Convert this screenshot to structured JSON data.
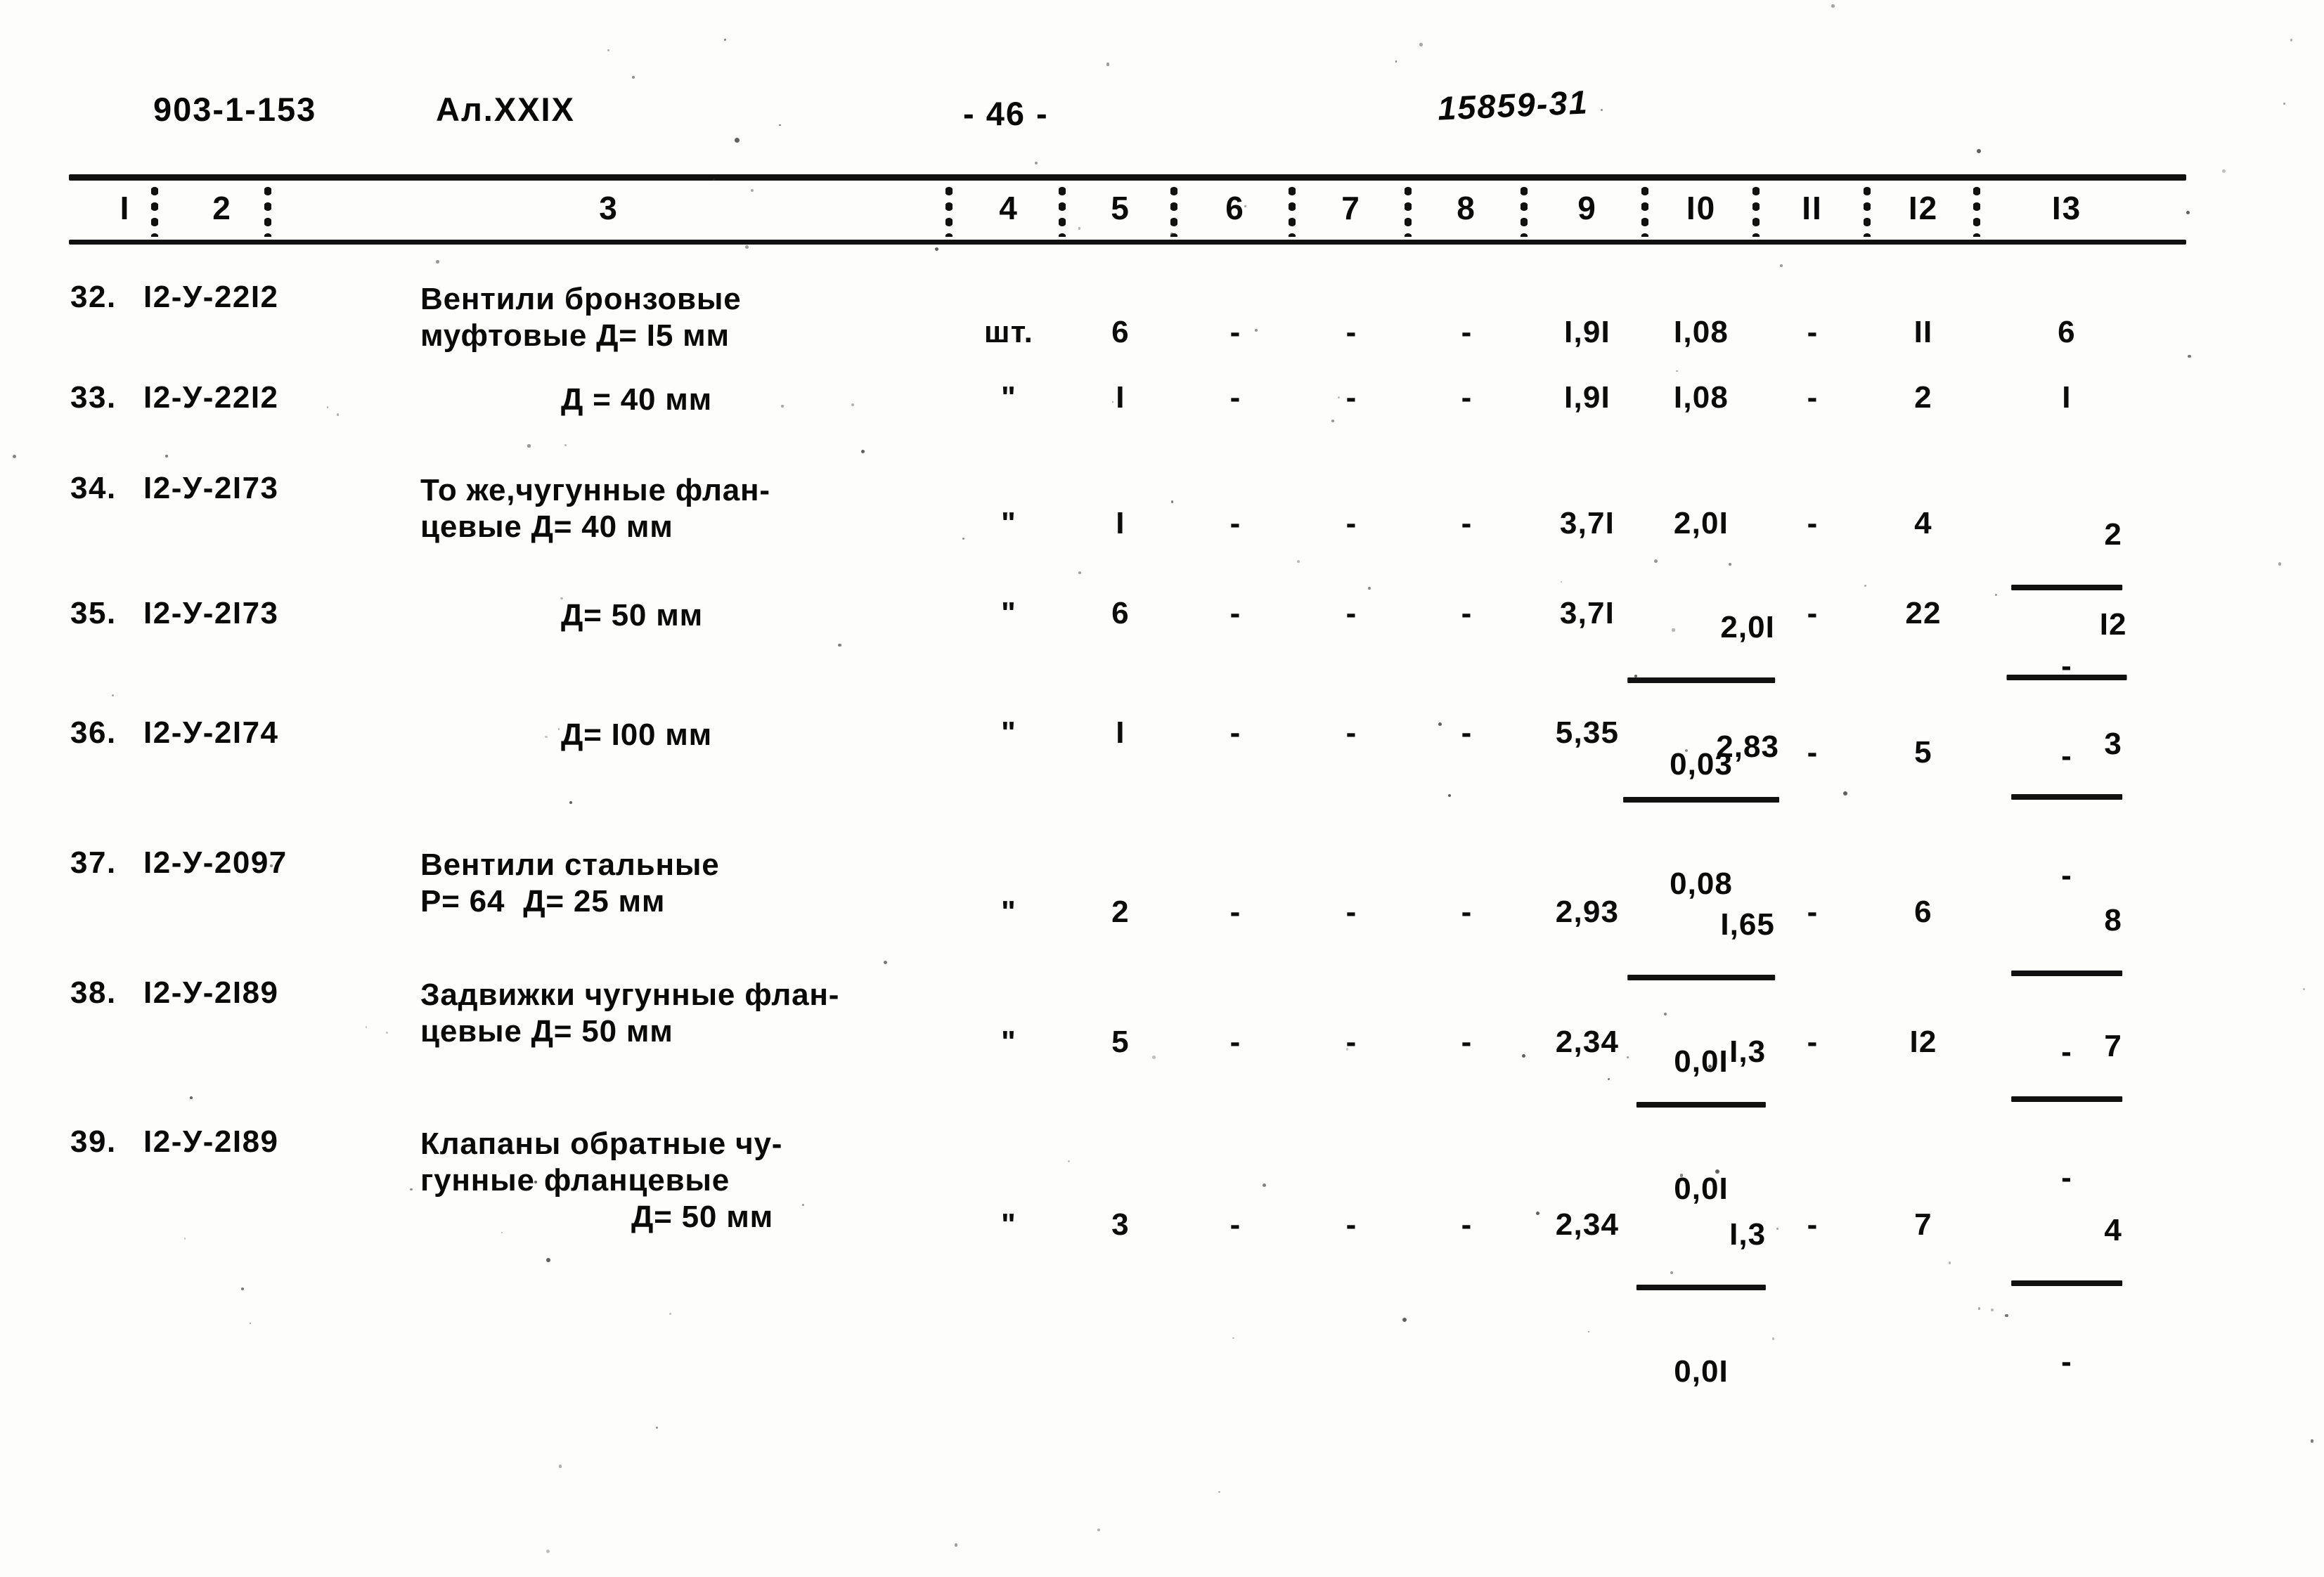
{
  "header": {
    "doc_code": "903-1-153",
    "album": "Ал.XXIX",
    "page_number": "- 46 -",
    "archive_stamp": "15859-31"
  },
  "table": {
    "column_numbers": [
      "I",
      "2",
      "3",
      "4",
      "5",
      "6",
      "7",
      "8",
      "9",
      "I0",
      "II",
      "I2",
      "I3"
    ],
    "rows": [
      {
        "index": "32.",
        "code": "I2-У-22I2",
        "desc_line1": "Вентили бронзовые",
        "desc_line2": "муфтовые Д= I5 мм",
        "desc_line3": "",
        "unit": "шт.",
        "c5": "6",
        "c6": "-",
        "c7": "-",
        "c8": "-",
        "c9": "I,9I",
        "c10_num": "I,08",
        "c10_den": "",
        "c11": "-",
        "c12": "II",
        "c13_num": "6",
        "c13_den": ""
      },
      {
        "index": "33.",
        "code": "I2-У-22I2",
        "desc_line1": "",
        "desc_line2": "Д = 40 мм",
        "desc_line3": "",
        "unit": "\"",
        "c5": "I",
        "c6": "-",
        "c7": "-",
        "c8": "-",
        "c9": "I,9I",
        "c10_num": "I,08",
        "c10_den": "",
        "c11": "-",
        "c12": "2",
        "c13_num": "I",
        "c13_den": ""
      },
      {
        "index": "34.",
        "code": "I2-У-2I73",
        "desc_line1": "То же,чугунные флан-",
        "desc_line2": "цевые Д= 40 мм",
        "desc_line3": "",
        "unit": "\"",
        "c5": "I",
        "c6": "-",
        "c7": "-",
        "c8": "-",
        "c9": "3,7I",
        "c10_num": "2,0I",
        "c10_den": "",
        "c11": "-",
        "c12": "4",
        "c13_num": "2",
        "c13_den": "-"
      },
      {
        "index": "35.",
        "code": "I2-У-2I73",
        "desc_line1": "",
        "desc_line2": "Д= 50 мм",
        "desc_line3": "",
        "unit": "\"",
        "c5": "6",
        "c6": "-",
        "c7": "-",
        "c8": "-",
        "c9": "3,7I",
        "c10_num": "2,0I",
        "c10_den": "0,03",
        "c11": "-",
        "c12": "22",
        "c13_num": "I2",
        "c13_den": "-"
      },
      {
        "index": "36.",
        "code": "I2-У-2I74",
        "desc_line1": "",
        "desc_line2": "Д= I00 мм",
        "desc_line3": "",
        "unit": "\"",
        "c5": "I",
        "c6": "-",
        "c7": "-",
        "c8": "-",
        "c9": "5,35",
        "c10_num": "2,83",
        "c10_den": "0,08",
        "c11": "-",
        "c12": "5",
        "c13_num": "3",
        "c13_den": "-"
      },
      {
        "index": "37.",
        "code": "I2-У-2097",
        "desc_line1": "Вентили стальные",
        "desc_line2": "Р= 64  Д= 25 мм",
        "desc_line3": "",
        "unit": "\"",
        "c5": "2",
        "c6": "-",
        "c7": "-",
        "c8": "-",
        "c9": "2,93",
        "c10_num": "I,65",
        "c10_den": "0,0I",
        "c11": "-",
        "c12": "6",
        "c13_num": "8",
        "c13_den": "-"
      },
      {
        "index": "38.",
        "code": "I2-У-2I89",
        "desc_line1": "Задвижки чугунные флан-",
        "desc_line2": "цевые Д= 50 мм",
        "desc_line3": "",
        "unit": "\"",
        "c5": "5",
        "c6": "-",
        "c7": "-",
        "c8": "-",
        "c9": "2,34",
        "c10_num": "I,3",
        "c10_den": "0,0I",
        "c11": "-",
        "c12": "I2",
        "c13_num": "7",
        "c13_den": "-"
      },
      {
        "index": "39.",
        "code": "I2-У-2I89",
        "desc_line1": "Клапаны обратные чу-",
        "desc_line2": "гунные фланцевые",
        "desc_line3": "Д= 50 мм",
        "unit": "\"",
        "c5": "3",
        "c6": "-",
        "c7": "-",
        "c8": "-",
        "c9": "2,34",
        "c10_num": "I,3",
        "c10_den": "0,0I",
        "c11": "-",
        "c12": "7",
        "c13_num": "4",
        "c13_den": "-"
      }
    ]
  }
}
